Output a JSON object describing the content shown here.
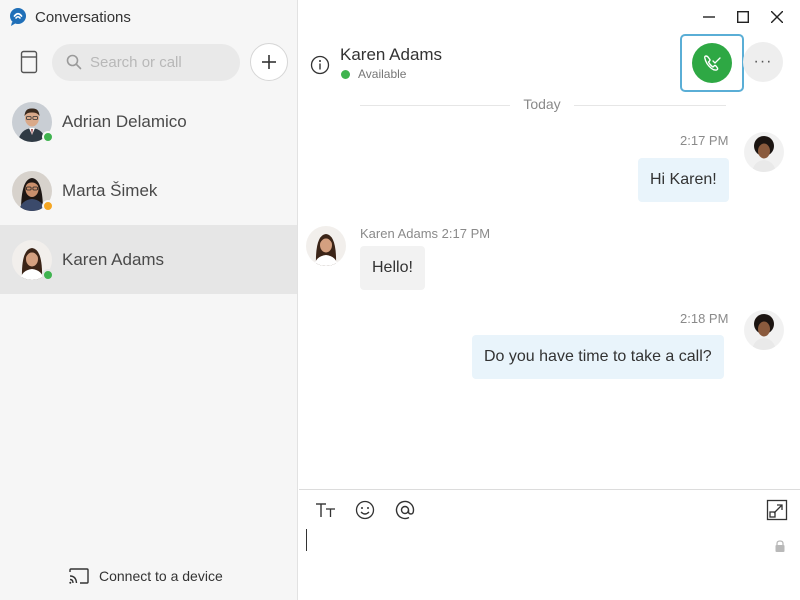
{
  "app": {
    "title": "Conversations"
  },
  "search": {
    "placeholder": "Search or call"
  },
  "conversations": [
    {
      "name": "Adrian Delamico",
      "presence": "available",
      "presence_color": "#3fb34f",
      "active": false
    },
    {
      "name": "Marta Šimek",
      "presence": "away",
      "presence_color": "#f5a623",
      "active": false
    },
    {
      "name": "Karen Adams",
      "presence": "available",
      "presence_color": "#3fb34f",
      "active": true
    }
  ],
  "footer": {
    "connect_label": "Connect to a device"
  },
  "chat": {
    "contact_name": "Karen Adams",
    "status": "Available",
    "status_color": "#3fb34f",
    "date_separator": "Today",
    "messages": [
      {
        "direction": "out",
        "time": "2:17 PM",
        "text": "Hi Karen!"
      },
      {
        "direction": "in",
        "sender": "Karen Adams",
        "time": "2:17 PM",
        "text": "Hello!"
      },
      {
        "direction": "out",
        "time": "2:18 PM",
        "text": "Do you have time to take a call?"
      }
    ]
  },
  "compose": {
    "value": "",
    "placeholder": ""
  },
  "colors": {
    "accent": "#2ea844",
    "focus_ring": "#5aaed6",
    "outgoing_bubble": "#e9f4fb"
  },
  "icons": [
    "app-logo-icon",
    "contacts-icon",
    "search-icon",
    "plus-icon",
    "cast-icon",
    "minimize-icon",
    "maximize-icon",
    "close-icon",
    "info-icon",
    "phone-icon",
    "more-icon",
    "text-format-icon",
    "emoji-icon",
    "mention-icon",
    "expand-icon",
    "lock-icon"
  ]
}
